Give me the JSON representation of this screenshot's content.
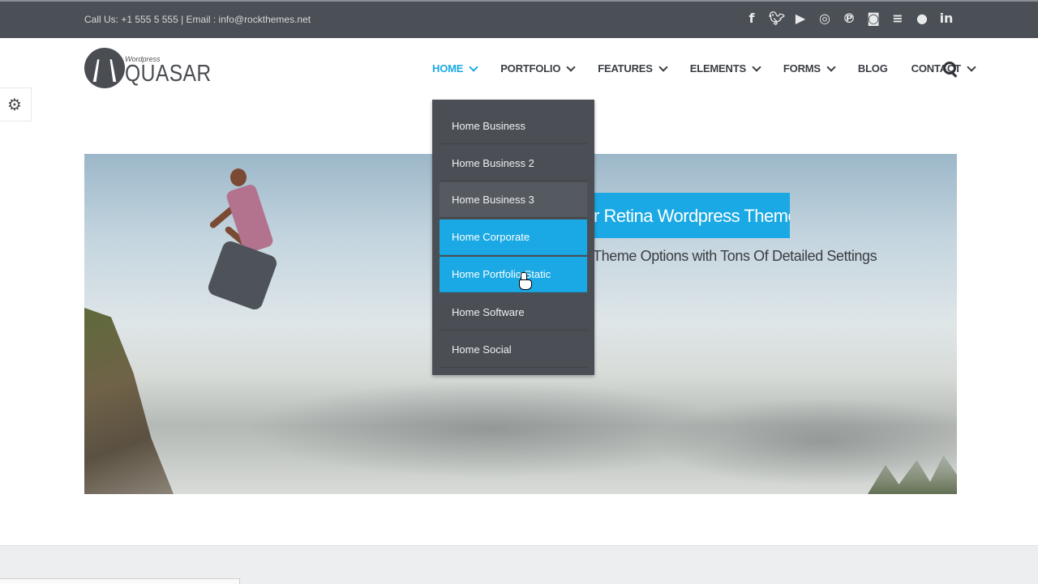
{
  "topbar": {
    "contact": "Call Us: +1 555 5 555 | Email : info@rockthemes.net",
    "social_icons": [
      "facebook-icon",
      "twitter-icon",
      "youtube-icon",
      "dribbble-icon",
      "pinterest-icon",
      "instagram-icon",
      "stackexchange-icon",
      "flickr-icon",
      "linkedin-icon"
    ]
  },
  "logo": {
    "small": "Wordpress",
    "name": "QUASAR"
  },
  "nav": {
    "items": [
      {
        "label": "HOME"
      },
      {
        "label": "PORTFOLIO"
      },
      {
        "label": "FEATURES"
      },
      {
        "label": "ELEMENTS"
      },
      {
        "label": "FORMS"
      },
      {
        "label": "BLOG"
      },
      {
        "label": "CONTACT"
      }
    ]
  },
  "dropdown": {
    "items": [
      "Home Business",
      "Home Business 2",
      "Home Business 3",
      "Home Corporate",
      "Home Portfolio Static",
      "Home Software",
      "Home Social"
    ]
  },
  "slide": {
    "title": "r Retina Wordpress Theme",
    "subtitle": "Theme Options with Tons Of Detailed Settings"
  },
  "colors": {
    "accent": "#1aa9e4",
    "topbar": "#4b4f56",
    "dropdown": "#4b4f55"
  }
}
